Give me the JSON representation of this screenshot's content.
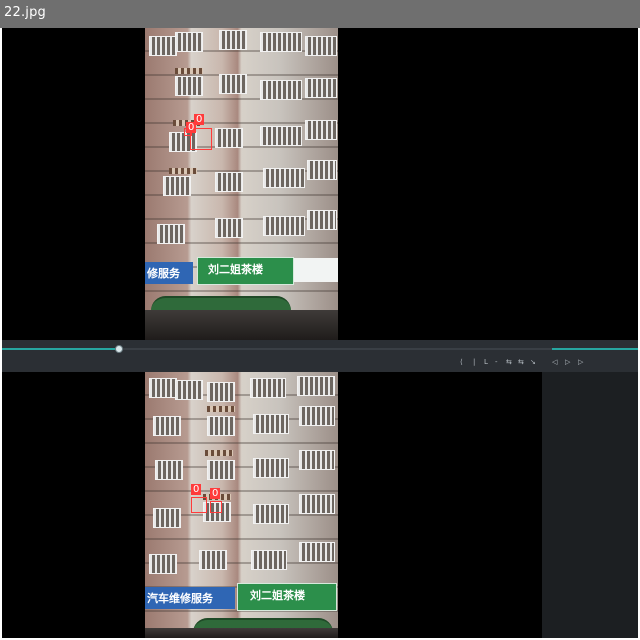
{
  "window": {
    "title": "22.jpg"
  },
  "top_view": {
    "shop_signs": {
      "left": "修服务",
      "left_sub": "",
      "middle": "刘二姐茶楼",
      "middle_sub": "",
      "right_brand": ""
    },
    "detections": [
      {
        "label": "0"
      },
      {
        "label": "0"
      }
    ]
  },
  "bottom_view": {
    "shop_signs": {
      "left": "汽车维修服务",
      "left_sub": "",
      "middle": "刘二姐茶楼",
      "middle_sub": ""
    },
    "detections": [
      {
        "label": "0"
      },
      {
        "label": "0"
      }
    ]
  },
  "timeline": {
    "left_time": "",
    "right_time": "",
    "controls": [
      "⟨",
      "|",
      "L",
      "-",
      "⇆",
      "⇆",
      "↘",
      "◁",
      "▷",
      "▷"
    ]
  },
  "colors": {
    "accent": "#27a6a0",
    "bbox": "#ff3b3b"
  }
}
